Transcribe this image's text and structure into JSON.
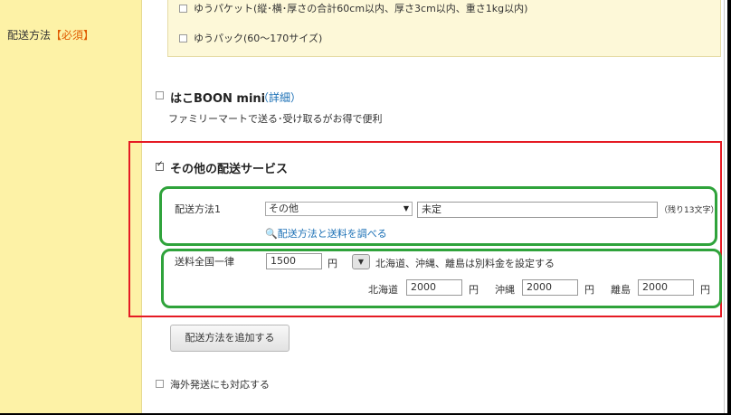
{
  "section_label": "配送方法",
  "required_label": "【必須】",
  "yupacket_label": "ゆうパケット(縦･横･厚さの合計60cm以内、厚さ3cm以内、重さ1kg以内)",
  "yupack_label": "ゆうパック(60～170サイズ)",
  "hako_boon": {
    "name": "はこBOON mini",
    "detail_link": "（詳細）",
    "description": "ファミリーマートで送る･受け取るがお得で便利"
  },
  "other_service": {
    "title": "その他の配送サービス",
    "method_label": "配送方法1",
    "method_select": "その他",
    "method_input": "未定",
    "remaining": "（残り13文字）",
    "search_link": "配送方法と送料を調べる",
    "flat_rate_label": "送料全国一律",
    "flat_rate_value": "1500",
    "yen": "円",
    "separate_note": "北海道、沖縄、離島は別料金を設定する",
    "hokkaido_label": "北海道",
    "hokkaido_value": "2000",
    "okinawa_label": "沖縄",
    "okinawa_value": "2000",
    "islands_label": "離島",
    "islands_value": "2000"
  },
  "add_button": "配送方法を追加する",
  "overseas_label": "海外発送にも対応する",
  "colors": {
    "highlight_red": "#e51b24",
    "highlight_green": "#2fa33b",
    "label_bg": "#fdf2a6",
    "link": "#1a6fb5"
  }
}
